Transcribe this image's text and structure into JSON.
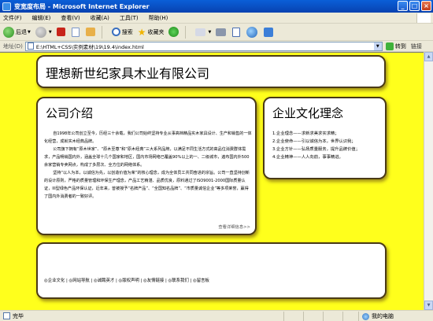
{
  "window": {
    "title": "变宽度布局 - Microsoft Internet Explorer",
    "controls": [
      "_",
      "□",
      "×"
    ]
  },
  "menu": [
    "文件(F)",
    "编辑(E)",
    "查看(V)",
    "收藏(A)",
    "工具(T)",
    "帮助(H)"
  ],
  "toolbar": {
    "back": "后退",
    "search": "搜索",
    "favorites": "收藏夹"
  },
  "address": {
    "label": "地址(D)",
    "value": "E:\\HTML+CSS\\实例素材\\19\\19.4\\index.html",
    "go": "转到",
    "links": "链接"
  },
  "page": {
    "header_title": "理想新世纪家具木业有限公司",
    "intro": {
      "heading": "公司介绍",
      "paragraphs": [
        "自1998年公司创立至今，历经三十余载，我们公司始终坚持专业从事高档精品实木家具设计、生产和销售的一体化经营，成就实木经典品牌。",
        "公司旗下拥有“原木世家”、“原木至尊”和“原木经典”三大系列品牌，以满足不同生活方式的高品位消费群体需求，产品畅销国内外，涵盖全球十几个国家和地区，国内市场网络已覆盖90%以上的一、二级城市，遍布国内外500余家营销专卖网点，构成了多层次、全方位的网络体系。",
        "坚持“以人为本，以诚信为先，以创造价值为荣”的核心理念，成为全体员工共同奋进的宗旨。公司一直坚持创新的设计原则，严格的质量管理和环保生产理念，产品工艺精湛、品质优良，原料通过了ISO9001-2000国际质量认证，III型绿色产品环保认证，近年来，曾被授予“名牌产品”、“全国知名品牌”、“市质量诚信企业”等多项荣誉，赢得了国内外消费者的一致好评。"
      ],
      "more": "查看详细信息>>"
    },
    "culture": {
      "heading": "企业文化理念",
      "items": [
        "1.企业理念——求新求美求实求精；",
        "2.企业使命——引以诚信为本，世界认识我；",
        "3.企业方针——弘扬质量服务，提升品牌价值；",
        "4.企业精神——人人向前，事事精进。"
      ]
    },
    "footer_links": "◎企业文化 | ◎网站导航 | ◎诚聘英才 | ◎版权声明 | ◎友情链接 | ◎联系我们 | ◎留言板"
  },
  "status": {
    "left": "完毕",
    "zone": "我的电脑"
  },
  "colors": {
    "page_bg": "#ffff1c",
    "panel_border": "#4a3a16",
    "titlebar": "#0a5fd8"
  }
}
